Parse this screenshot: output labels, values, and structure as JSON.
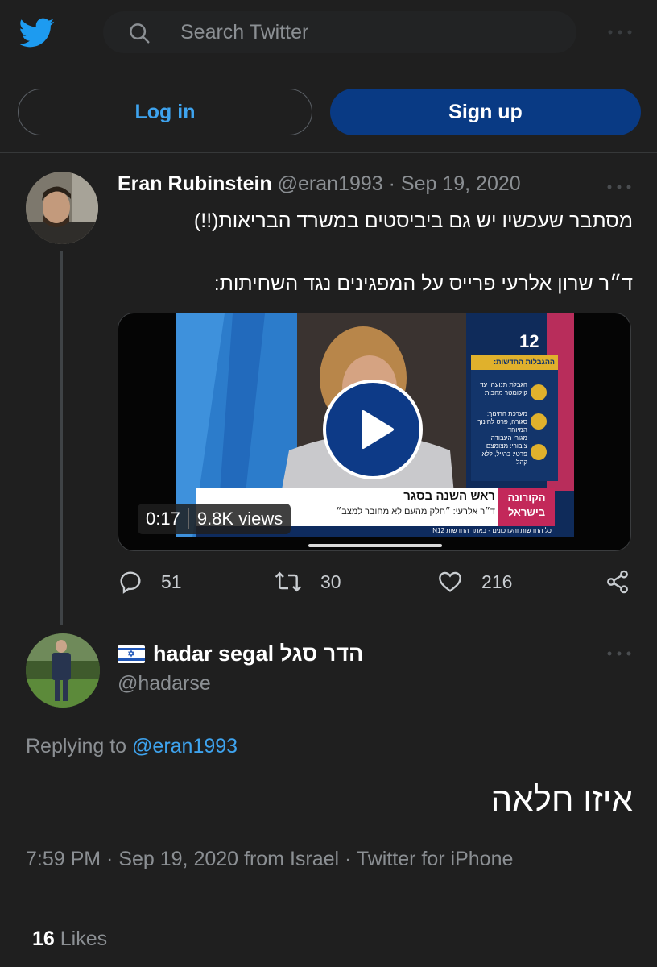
{
  "header": {
    "search_placeholder": "Search Twitter",
    "login_label": "Log in",
    "signup_label": "Sign up"
  },
  "tweet1": {
    "display_name": "Eran Rubinstein",
    "handle": "@eran1993",
    "separator": "·",
    "date": "Sep 19, 2020",
    "text_line1": "מסתבר שעכשיו יש גם ביביסטים במשרד הבריאות(!!)",
    "text_line2": "ד״ר שרון אלרעי פרייס על המפגינים נגד השחיתות:",
    "video": {
      "duration": "0:17",
      "views": "9.8K views",
      "channel_badge": "12",
      "panel_title": "ההגבלות החדשות:",
      "panel_items": [
        "הגבלת תנועה: עד קילומטר מהבית",
        "מערכת החינוך: סגורה, פרט לחינוך המיוחד",
        "מגורי העבודה: ציבורי: מצומצם פרטי: כרגיל, ללא קהל"
      ],
      "lower_third_title": "ראש השנה בסגר",
      "lower_third_subtitle": "ד״ר אלרעי: ״חלק מהעם לא מחובר למצב״",
      "lower_third_brand": "הקורונה בישראל",
      "ticker": "כל החדשות והעדכונים - באתר החדשות N12"
    },
    "stats": {
      "replies": "51",
      "retweets": "30",
      "likes": "216"
    }
  },
  "tweet2": {
    "display_name": "hadar segal הדר סגל",
    "handle": "@hadarse",
    "replying_prefix": "Replying to",
    "replying_handle": "@eran1993",
    "text": "איזו חלאה",
    "timestamp": "7:59 PM · Sep 19, 2020 from Israel · Twitter for iPhone",
    "likes_count": "16",
    "likes_label": "Likes"
  },
  "colors": {
    "background": "#1f1f1f",
    "accent_blue": "#3ea3ee",
    "signup_bg": "#093a84",
    "secondary_text": "#8b8f93"
  },
  "icons": [
    "twitter-bird-icon",
    "search-icon",
    "more-icon",
    "reply-icon",
    "retweet-icon",
    "like-icon",
    "share-icon",
    "play-icon",
    "israel-flag-icon"
  ]
}
